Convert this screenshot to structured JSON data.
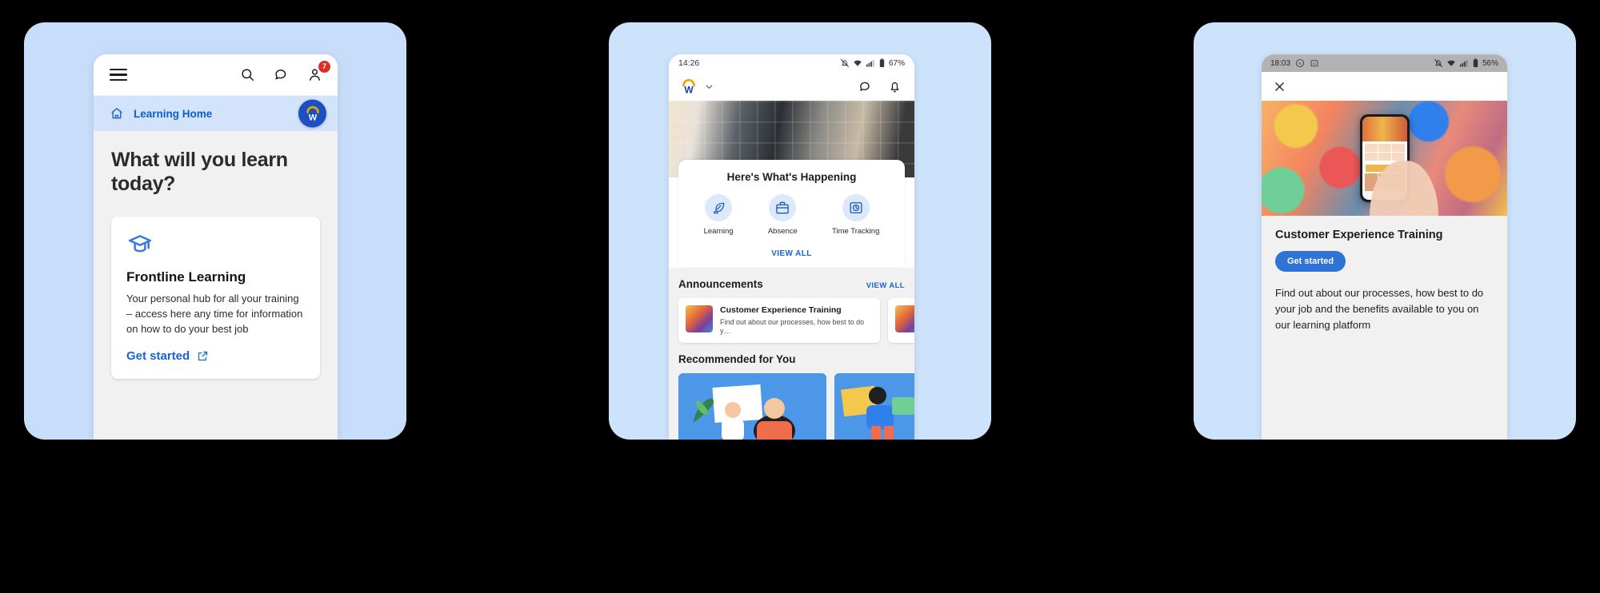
{
  "theme": {
    "background": "#000000",
    "panel_bg": "#cbe0fb",
    "accent_blue": "#1a63d4",
    "workday_blue": "#0b3e91",
    "workday_orange": "#f0a500",
    "badge_red": "#d93025",
    "screen_gray": "#f1f1f1"
  },
  "phone1": {
    "appbar": {
      "menu_icon": "hamburger-menu-icon",
      "search_icon": "search-icon",
      "chat_icon": "chat-bubble-icon",
      "profile_icon": "person-icon",
      "notification_count": "7"
    },
    "breadcrumb": {
      "home_icon": "home-icon",
      "label": "Learning Home",
      "avatar_letter": "W",
      "avatar_name": "workday-avatar"
    },
    "title": "What will you learn today?",
    "card": {
      "icon": "graduation-cap-icon",
      "heading": "Frontline Learning",
      "body": "Your personal hub for all your training – access here any time for information on how to do your best job",
      "link_label": "Get started",
      "link_icon": "external-link-icon"
    }
  },
  "phone2": {
    "status_bar": {
      "time": "14:26",
      "mute_icon": "bell-muted-icon",
      "wifi_icon": "wifi-icon",
      "signal_icon": "signal-bars-icon",
      "battery_icon": "battery-icon",
      "battery_label": "67%"
    },
    "topbar": {
      "logo": "workday-logo",
      "chevron_icon": "chevron-down-icon",
      "chat_icon": "chat-bubble-icon",
      "bell_icon": "notification-bell-icon"
    },
    "sheet": {
      "heading": "Here's What's Happening",
      "quick_actions": [
        {
          "label": "Learning",
          "icon": "learning-leaf-icon"
        },
        {
          "label": "Absence",
          "icon": "absence-bag-icon"
        },
        {
          "label": "Time Tracking",
          "icon": "time-tracking-clock-icon"
        }
      ],
      "view_all": "VIEW ALL"
    },
    "announcements": {
      "heading": "Announcements",
      "view_all": "VIEW ALL",
      "items": [
        {
          "title": "Customer Experience Training",
          "subtitle": "Find out about our processes, how best to do y…",
          "thumb": "graffiti-thumbnail"
        },
        {
          "title": "",
          "subtitle": "",
          "thumb": "second-thumbnail"
        }
      ]
    },
    "recommended": {
      "heading": "Recommended for You",
      "tiles": [
        {
          "name": "illustration-tile-1"
        },
        {
          "name": "illustration-tile-2"
        }
      ]
    }
  },
  "phone3": {
    "status_bar": {
      "time": "18:03",
      "whatsapp_icon": "whatsapp-icon",
      "calendar_icon": "calendar-icon",
      "mute_icon": "bell-muted-icon",
      "wifi_icon": "wifi-icon",
      "signal_icon": "signal-bars-icon",
      "battery_icon": "battery-icon",
      "battery_label": "56%"
    },
    "appbar": {
      "close_icon": "close-x-icon"
    },
    "hero": {
      "name": "graffiti-hand-phone-photo"
    },
    "content": {
      "heading": "Customer Experience Training",
      "button_label": "Get started",
      "body": "Find out about our processes, how best to do your job and the benefits available to you on our learning platform"
    }
  }
}
